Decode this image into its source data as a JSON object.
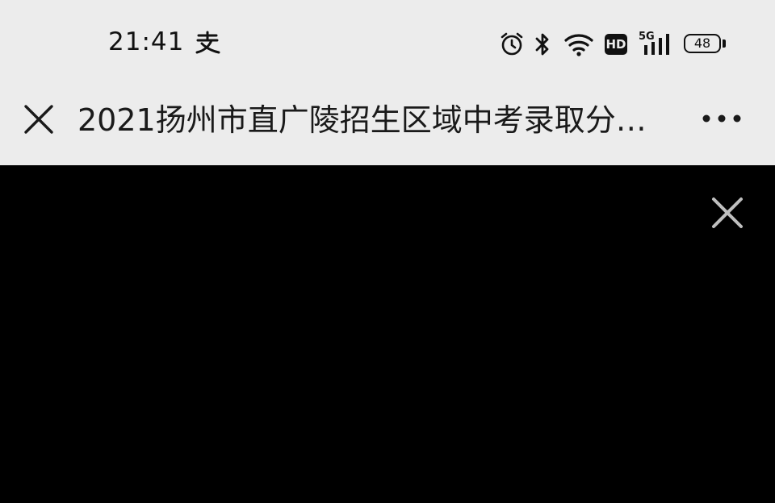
{
  "status_bar": {
    "time": "21:41",
    "battery_level": "48",
    "network_label": "5G",
    "hd_label": "HD",
    "icons": [
      "alipay-icon",
      "alarm-icon",
      "bluetooth-icon",
      "wifi-icon",
      "hd-icon",
      "signal-5g-icon",
      "battery-icon"
    ]
  },
  "title_bar": {
    "title": "2021扬州市直广陵招生区域中考录取分…",
    "close_icon": "close-icon",
    "more_icon": "more-icon"
  },
  "content": {
    "overlay_close_icon": "close-icon"
  },
  "colors": {
    "bar_background": "#ececec",
    "content_background": "#000000",
    "text": "#1a1a1a",
    "overlay_close": "#bfbfbf"
  }
}
